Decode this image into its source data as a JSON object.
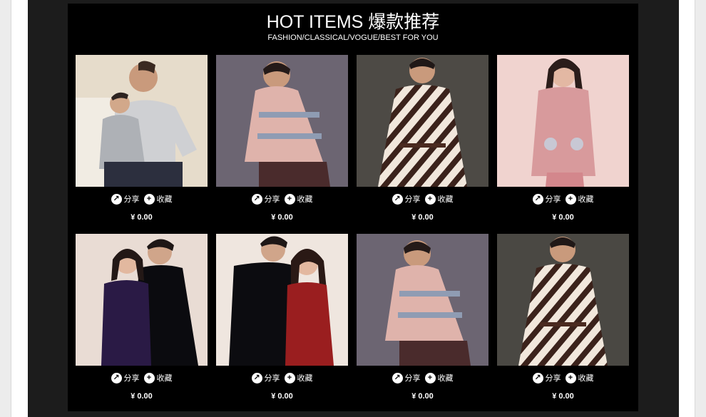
{
  "section": {
    "title": "HOT ITEMS 爆款推荐",
    "subtitle": "FASHION/CLASSICAL/VOGUE/BEST FOR YOU"
  },
  "labels": {
    "share": "分享",
    "favorite": "收藏",
    "share_icon": "share-arrow-icon",
    "favorite_icon": "plus-circle-icon"
  },
  "products": [
    {
      "price": "¥ 0.00",
      "photo": "father-and-son-grey-pajamas"
    },
    {
      "price": "¥ 0.00",
      "photo": "man-pink-striped-fleece-pajamas"
    },
    {
      "price": "¥ 0.00",
      "photo": "man-brown-checked-pajamas"
    },
    {
      "price": "¥ 0.00",
      "photo": "woman-pink-fleece-pajamas"
    },
    {
      "price": "¥ 0.00",
      "photo": "couple-purple-black-thermals"
    },
    {
      "price": "¥ 0.00",
      "photo": "couple-black-red-thermals"
    },
    {
      "price": "¥ 0.00",
      "photo": "man-pink-striped-fleece-pajamas"
    },
    {
      "price": "¥ 0.00",
      "photo": "man-brown-checked-pajamas"
    }
  ],
  "colors": {
    "page_bg": "#ececec",
    "band_bg": "#1c1c1c",
    "panel_bg": "#000000",
    "text": "#ffffff"
  }
}
